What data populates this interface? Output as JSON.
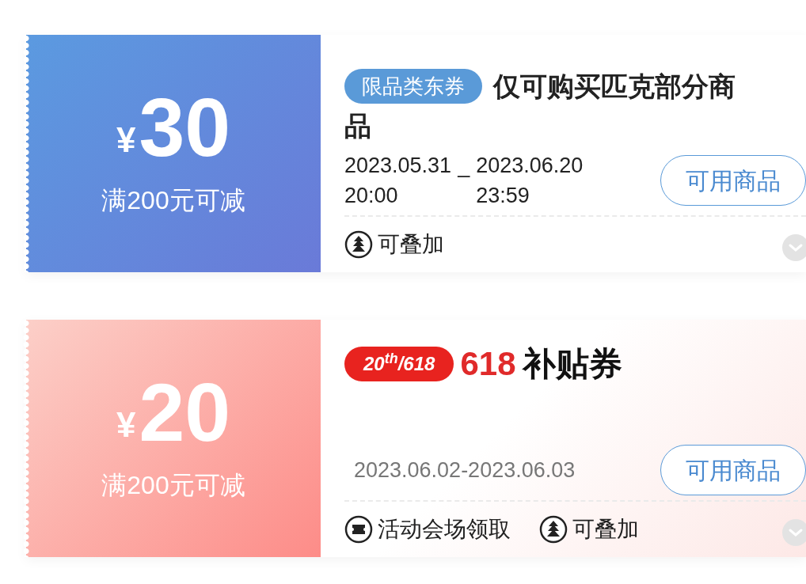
{
  "coupons": [
    {
      "kind": "blue",
      "currency": "¥",
      "amount": "30",
      "condition": "满200元可减",
      "tag": "限品类东券",
      "title_lines": [
        "仅可购买匹克部分商",
        "品"
      ],
      "dates": {
        "start": "2023.05.31",
        "separator": "_",
        "end": "2023.06.20",
        "start_time": "20:00",
        "end_time": "23:59"
      },
      "button": "可用商品",
      "features": [
        {
          "kind": "stack",
          "label": "可叠加"
        }
      ]
    },
    {
      "kind": "red",
      "currency": "¥",
      "amount": "20",
      "condition": "满200元可减",
      "logo": {
        "badge": "20$^{th}$/618",
        "number": "618",
        "text": "补贴券"
      },
      "date_range": "2023.06.02-2023.06.03",
      "button": "可用商品",
      "features": [
        {
          "kind": "ticket",
          "label": "活动会场领取"
        },
        {
          "kind": "stack",
          "label": "可叠加"
        }
      ]
    }
  ]
}
